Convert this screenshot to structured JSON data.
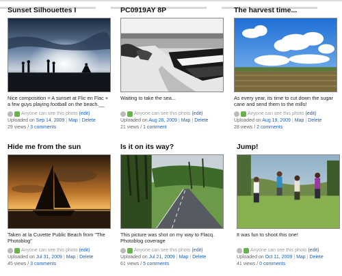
{
  "permission_text": "Anyone can see this photo",
  "edit_label": "(edit)",
  "uploaded_on_label": "Uploaded on",
  "map_label": "Map",
  "delete_label": "Delete",
  "views_suffix": "views /",
  "photos": [
    {
      "title": "Sunset Silhouettes I",
      "description": "Nice composition = A sunset at Flic en Flac + a few guys playing football on the beach.__",
      "upload_date": "Sep 14, 2009",
      "views": "29",
      "comments": "3 comments"
    },
    {
      "title": "PC0919AY 8P",
      "description": "Waiting to take the sea...",
      "upload_date": "Aug 26, 2009",
      "views": "21",
      "comments": "1 comment"
    },
    {
      "title": "The harvest time...",
      "description": "As every year, its time to cut down the sugar cane and send them to the mills!",
      "upload_date": "Aug 19, 2009",
      "views": "28",
      "comments": "2 comments"
    },
    {
      "title": "Hide me from the sun",
      "description": "Taken at la Cuvette Public Beach from \"The Photoblog\"",
      "upload_date": "Jul 31, 2009",
      "views": "45",
      "comments": "3 comments"
    },
    {
      "title": "Is it on its way?",
      "description": "This picture was shot on my way to Flacq. Photoblog coverage",
      "upload_date": "Jul 21, 2009",
      "views": "61",
      "comments": "5 comments"
    },
    {
      "title": "Jump!",
      "description": "It was fun to shoot this one!",
      "upload_date": "Oct 11, 2009",
      "views": "41",
      "comments": "0 comments"
    }
  ]
}
